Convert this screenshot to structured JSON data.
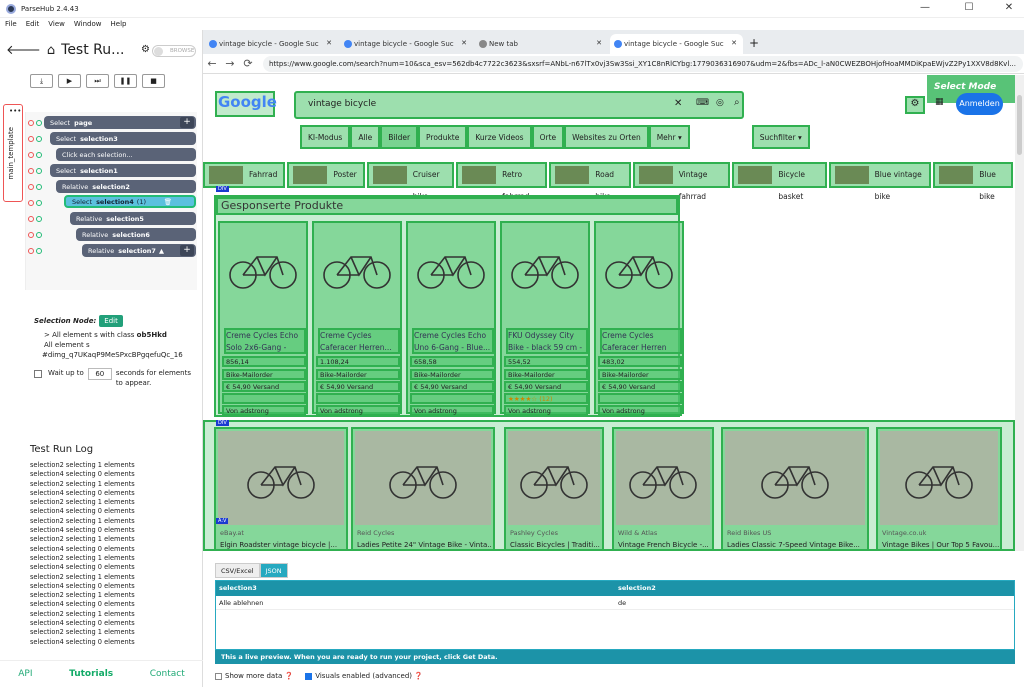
{
  "window": {
    "title": "ParseHub 2.4.43",
    "minimize": "—",
    "maximize": "☐",
    "close": "✕"
  },
  "menu": [
    "File",
    "Edit",
    "View",
    "Window",
    "Help"
  ],
  "left": {
    "back": "🡐",
    "home": "⌂",
    "title": "Test Ru...",
    "gear": "⚙",
    "browse": "BROWSE",
    "run_controls": [
      "⤓",
      "▶",
      "⏭",
      "❚❚",
      "■"
    ],
    "more": "•••",
    "template_tab": "main_template",
    "tree": [
      {
        "kind": "Select",
        "name": "page",
        "extra": ""
      },
      {
        "kind": "Select",
        "name": "selection3",
        "extra": ""
      },
      {
        "kind": "",
        "name": "Click each selection...",
        "extra": ""
      },
      {
        "kind": "Select",
        "name": "selection1",
        "extra": ""
      },
      {
        "kind": "Relative",
        "name": "selection2",
        "extra": ""
      },
      {
        "kind": "Select",
        "name": "selection4",
        "extra": "(1)"
      },
      {
        "kind": "Relative",
        "name": "selection5",
        "extra": ""
      },
      {
        "kind": "Relative",
        "name": "selection6",
        "extra": ""
      },
      {
        "kind": "Relative",
        "name": "selection7",
        "extra": ""
      }
    ],
    "selection_node_label": "Selection Node:",
    "edit": "Edit",
    "sel_line1_pre": "> All element s with class ",
    "sel_line1_b": "ob5Hkd",
    "sel_line2": "All element s",
    "sel_line3": "#dimg_q7UKaqP9MeSPxcBPgqefuQc_16",
    "wait_pre": "Wait up to",
    "wait_val": "60",
    "wait_post": "seconds for elements to appear.",
    "log_title": "Test Run Log",
    "log": [
      "selection2 selecting 1 elements",
      "selection4 selecting 0 elements",
      "selection2 selecting 1 elements",
      "selection4 selecting 0 elements",
      "selection2 selecting 1 elements",
      "selection4 selecting 0 elements",
      "selection2 selecting 1 elements",
      "selection4 selecting 0 elements",
      "selection2 selecting 1 elements",
      "selection4 selecting 0 elements",
      "selection2 selecting 1 elements",
      "selection4 selecting 0 elements",
      "selection2 selecting 1 elements",
      "selection4 selecting 0 elements",
      "selection2 selecting 1 elements",
      "selection4 selecting 0 elements",
      "selection2 selecting 1 elements",
      "selection4 selecting 0 elements",
      "selection2 selecting 1 elements",
      "selection4 selecting 0 elements"
    ],
    "footer": [
      "API",
      "Tutorials",
      "Contact"
    ]
  },
  "browser": {
    "tabs": [
      "vintage bicycle - Google Suc",
      "vintage bicycle - Google Suc",
      "New tab",
      "vintage bicycle - Google Suc"
    ],
    "newtab": "+",
    "url": "https://www.google.com/search?num=10&sca_esv=562db4c7722c3623&sxsrf=ANbL-n67lTx0vj3Sw3Ssi_XY1C8nRlCYbg:1779036316907&udm=2&fbs=ADc_l-aN0CWEZBOHjofHoaMMDiKpaEWjvZ2Py1XXV8d8Kvl...",
    "back": "←",
    "fwd": "→",
    "reload": "⟳"
  },
  "google": {
    "logo": "Google",
    "query": "vintage bicycle",
    "select_mode": "Select Mode",
    "signin": "Anmelden",
    "nav": [
      "KI-Modus",
      "Alle",
      "Bilder",
      "Produkte",
      "Kurze Videos",
      "Orte",
      "Websites zu Orten",
      "Mehr ▾",
      "Suchfilter ▾"
    ],
    "chips": [
      "Fahrrad",
      "Poster",
      "Cruiser bike",
      "Retro fahrrad",
      "Road bike",
      "Vintage fahrrad",
      "Bicycle basket",
      "Blue vintage bike",
      "Blue bike"
    ],
    "div_badge": "DIV",
    "sponsored": "Gesponserte Produkte",
    "products": [
      {
        "title": "Creme Cycles Echo Solo 2x6-Gang - Lig...",
        "price": "856,14",
        "seller": "Bike-Mailorder",
        "ship": "€ 54,90 Versand",
        "extra": "",
        "by": "Von adstrong"
      },
      {
        "title": "Creme Cycles Caferacer Herren...",
        "price": "1.108,24",
        "seller": "Bike-Mailorder",
        "ship": "€ 54,90 Versand",
        "extra": "",
        "by": "Von adstrong"
      },
      {
        "title": "Creme Cycles Echo Uno 6-Gang - Blue...",
        "price": "658,58",
        "seller": "Bike-Mailorder",
        "ship": "€ 54,90 Versand",
        "extra": "",
        "by": "Von adstrong"
      },
      {
        "title": "FKU Odyssey City Bike - black 59 cm - L...",
        "price": "554,52",
        "seller": "Bike-Mailorder",
        "ship": "€ 54,90 Versand",
        "extra": "★★★★☆ (12)",
        "by": "Von adstrong"
      },
      {
        "title": "Creme Cycles Caferacer Herren Un...",
        "price": "483,02",
        "seller": "Bike-Mailorder",
        "ship": "€ 54,90 Versand",
        "extra": "",
        "by": "Von adstrong"
      }
    ],
    "images": [
      {
        "source": "eBay.at",
        "title": "Elgin Roadster vintage bicycle |..."
      },
      {
        "source": "Reid Cycles",
        "title": "Ladies Petite 24\" Vintage Bike - Vinta..."
      },
      {
        "source": "Pashley Cycles",
        "title": "Classic Bicycles | Traditi..."
      },
      {
        "source": "Wild & Atlas",
        "title": "Vintage French Bicycle -..."
      },
      {
        "source": "Reid Bikes US",
        "title": "Ladies Classic 7-Speed Vintage Bike..."
      },
      {
        "source": "Vintage.co.uk",
        "title": "Vintage Bikes | Our Top 5 Favou..."
      }
    ],
    "a_badge": "A:V"
  },
  "preview": {
    "tabs": [
      "CSV/Excel",
      "JSON"
    ],
    "headers": [
      "selection3",
      "selection2"
    ],
    "row": [
      "Alle ablehnen",
      "de"
    ],
    "note": "This a live preview. When you are ready to run your project, click Get Data.",
    "show_more": "Show more data ❓",
    "visuals": "Visuals enabled (advanced) ❓"
  }
}
